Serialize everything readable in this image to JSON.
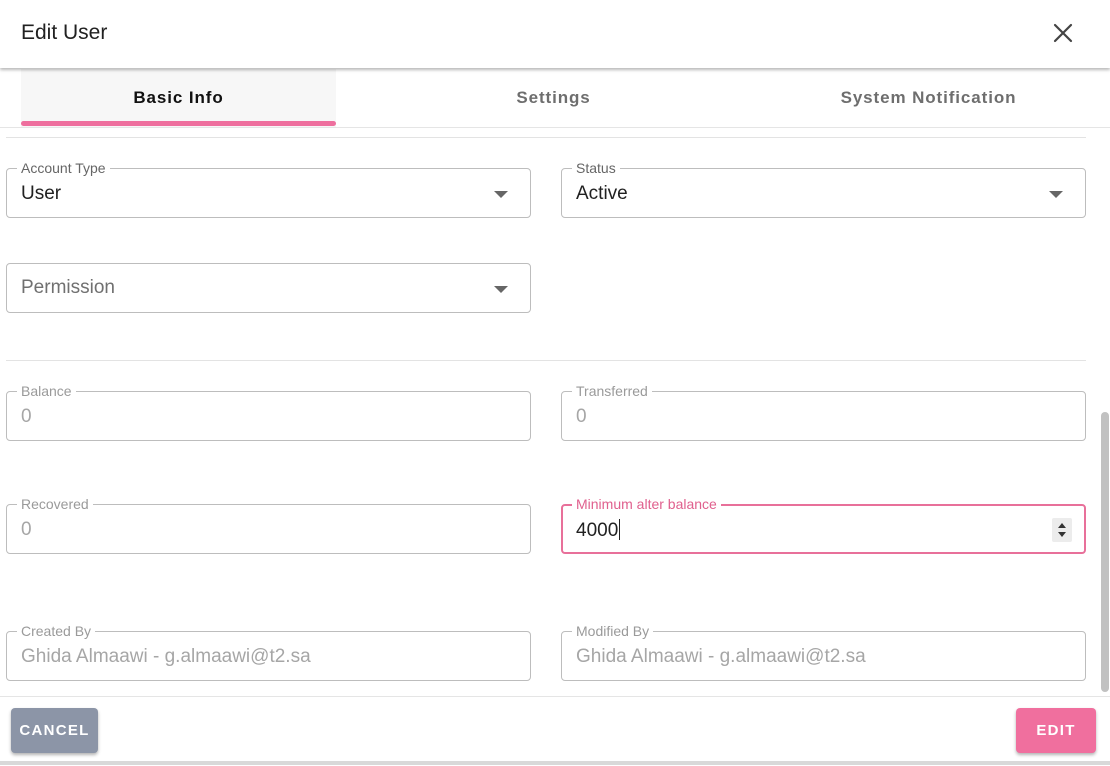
{
  "dialog": {
    "title": "Edit User",
    "close_icon": "close-icon"
  },
  "tabs": [
    {
      "label": "Basic Info",
      "active": true
    },
    {
      "label": "Settings",
      "active": false
    },
    {
      "label": "System Notification",
      "active": false
    }
  ],
  "fields": {
    "account_type": {
      "label": "Account Type",
      "value": "User"
    },
    "status": {
      "label": "Status",
      "value": "Active"
    },
    "permission": {
      "placeholder": "Permission"
    },
    "balance": {
      "label": "Balance",
      "value": "0"
    },
    "transferred": {
      "label": "Transferred",
      "value": "0"
    },
    "recovered": {
      "label": "Recovered",
      "value": "0"
    },
    "minimum_alter_balance": {
      "label": "Minimum alter balance",
      "value": "4000"
    },
    "created_by": {
      "label": "Created By",
      "value": "Ghida Almaawi - g.almaawi@t2.sa"
    },
    "modified_by": {
      "label": "Modified By",
      "value": "Ghida Almaawi - g.almaawi@t2.sa"
    }
  },
  "footer": {
    "cancel_label": "CANCEL",
    "edit_label": "EDIT"
  },
  "colors": {
    "accent": "#ee6f9e",
    "cancel_button": "#8c95a7",
    "edit_button": "#f06f9e"
  }
}
